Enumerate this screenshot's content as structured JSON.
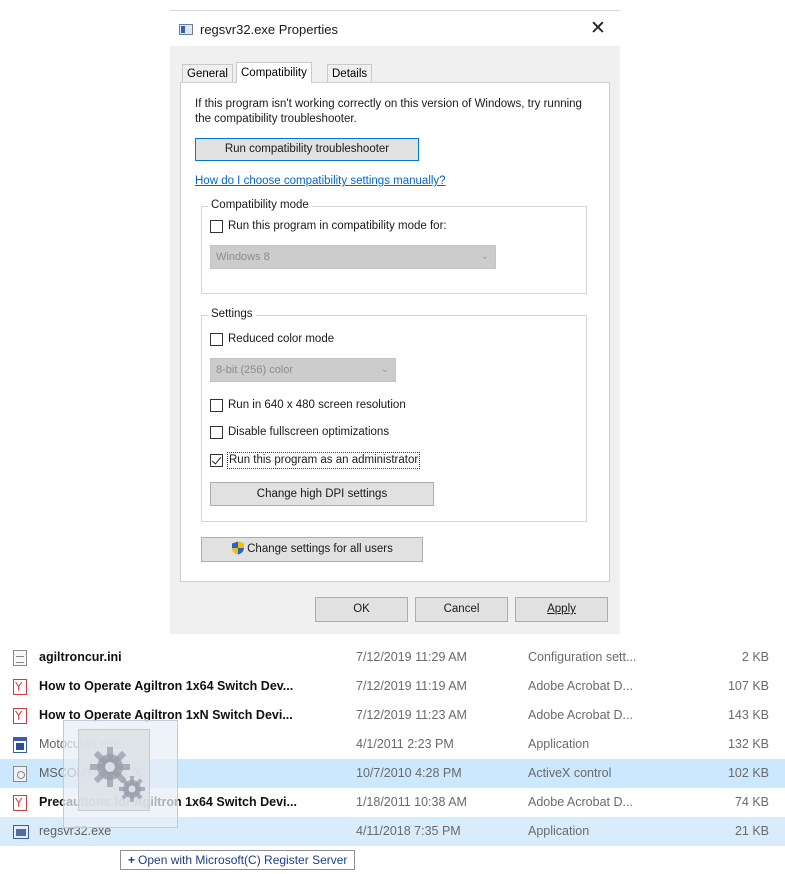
{
  "dialog": {
    "title": "regsvr32.exe Properties",
    "close": "✕",
    "tabs": [
      {
        "label": "General",
        "active": false
      },
      {
        "label": "Compatibility",
        "active": true
      },
      {
        "label": "Details",
        "active": false
      }
    ],
    "intro": "If this program isn't working correctly on this version of Windows, try running the compatibility troubleshooter.",
    "troubleshoot_button": "Run compatibility troubleshooter",
    "help_link": "How do I choose compatibility settings manually?",
    "compat_mode": {
      "label": "Compatibility mode",
      "checkbox_label": "Run this program in compatibility mode for:",
      "checked": false,
      "selected_os": "Windows 8"
    },
    "settings": {
      "label": "Settings",
      "reduced_color": {
        "label": "Reduced color mode",
        "checked": false
      },
      "color_select": "8-bit (256) color",
      "res_640": {
        "label": "Run in 640 x 480 screen resolution",
        "checked": false
      },
      "fullscreen_opt": {
        "label": "Disable fullscreen optimizations",
        "checked": false
      },
      "run_admin": {
        "label": "Run this program as an administrator",
        "checked": true
      },
      "dpi_button": "Change high DPI settings"
    },
    "all_users_button": "Change settings for all users",
    "footer": {
      "ok": "OK",
      "cancel": "Cancel",
      "apply": "Apply"
    }
  },
  "files": [
    {
      "name": "agiltroncur.ini",
      "date": "7/12/2019 11:29 AM",
      "type": "Configuration sett...",
      "size": "2 KB",
      "icon": "ini-file-icon"
    },
    {
      "name": "How to Operate Agiltron 1x64 Switch Dev...",
      "date": "7/12/2019 11:19 AM",
      "type": "Adobe Acrobat D...",
      "size": "107 KB",
      "icon": "pdf-icon"
    },
    {
      "name": "How to Operate Agiltron 1xN Switch Devi...",
      "date": "7/12/2019 11:23 AM",
      "type": "Adobe Acrobat D...",
      "size": "143 KB",
      "icon": "pdf-icon"
    },
    {
      "name": "Motoculan.exe",
      "date": "4/1/2011 2:23 PM",
      "type": "Application",
      "size": "132 KB",
      "icon": "application-icon"
    },
    {
      "name": "MSCOMM32.OCX",
      "date": "10/7/2010 4:28 PM",
      "type": "ActiveX control",
      "size": "102 KB",
      "icon": "activex-icon"
    },
    {
      "name": "Precautions for Agiltron 1x64 Switch Devi...",
      "date": "1/18/2011 10:38 AM",
      "type": "Adobe Acrobat D...",
      "size": "74 KB",
      "icon": "pdf-icon"
    },
    {
      "name": "regsvr32.exe",
      "date": "4/11/2018 7:35 PM",
      "type": "Application",
      "size": "21 KB",
      "icon": "exe-icon"
    }
  ],
  "drag_tooltip": {
    "plus": "+",
    "text": "Open with Microsoft(C) Register Server"
  }
}
